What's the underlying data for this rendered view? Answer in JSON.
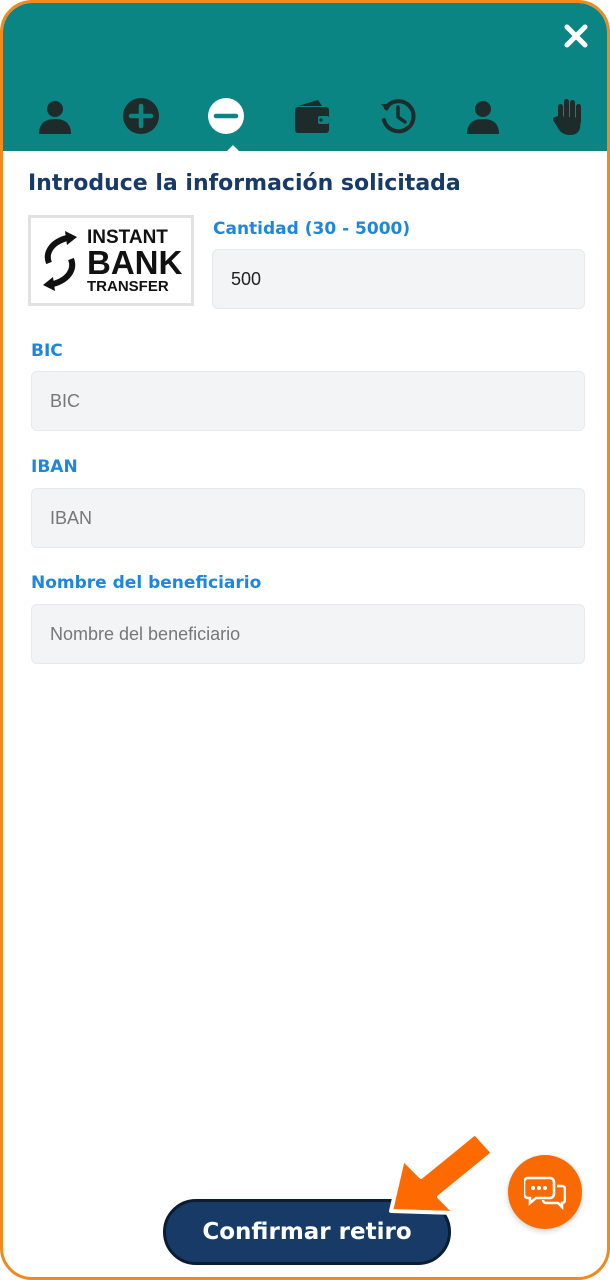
{
  "colors": {
    "header": "#0b8484",
    "frame": "#f08a1e",
    "title": "#173a66",
    "label": "#1f86dd",
    "button": "#173a66",
    "chat": "#fa6a04",
    "arrow": "#ff6a00"
  },
  "nav": {
    "icons": [
      "user-icon",
      "deposit-plus-icon",
      "withdraw-minus-icon",
      "wallet-icon",
      "history-icon",
      "profile-icon",
      "hand-stop-icon"
    ],
    "active_index": 2
  },
  "form": {
    "title": "Introduce la información solicitada",
    "logo": {
      "line1": "INSTANT",
      "line2": "BANK",
      "line3": "TRANSFER"
    },
    "amount": {
      "label": "Cantidad (30 - 5000)",
      "value": "500"
    },
    "bic": {
      "label": "BIC",
      "placeholder": "BIC"
    },
    "iban": {
      "label": "IBAN",
      "placeholder": "IBAN"
    },
    "beneficiary": {
      "label": "Nombre del beneficiario",
      "placeholder": "Nombre del beneficiario"
    }
  },
  "confirm_label": "Confirmar retiro"
}
